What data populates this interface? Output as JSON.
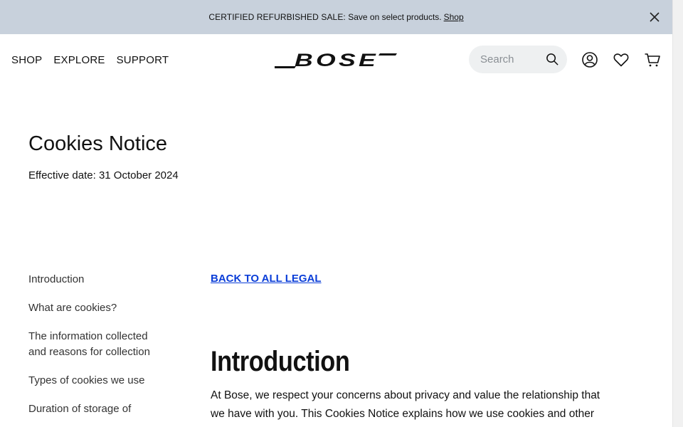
{
  "promo": {
    "lead": "CERTIFIED REFURBISHED SALE:",
    "text": "Save on select products.",
    "link": "Shop"
  },
  "nav": {
    "items": [
      "SHOP",
      "EXPLORE",
      "SUPPORT"
    ]
  },
  "brand": "BOSE",
  "search": {
    "placeholder": "Search"
  },
  "page": {
    "title": "Cookies Notice",
    "effective_date": "Effective date: 31 October 2024"
  },
  "toc": {
    "items": [
      "Introduction",
      "What are cookies?",
      "The information collected and reasons for collection",
      "Types of cookies we use",
      "Duration of storage of"
    ]
  },
  "content": {
    "back_link": "BACK TO ALL LEGAL",
    "section_title": "Introduction",
    "section_body": "At Bose, we respect your concerns about privacy and value the relationship that we have with you. This Cookies Notice explains how we use cookies and other"
  },
  "colors": {
    "promo_bg": "#c8d1dc",
    "link": "#0a3dd8",
    "search_bg": "#eef0f1"
  }
}
